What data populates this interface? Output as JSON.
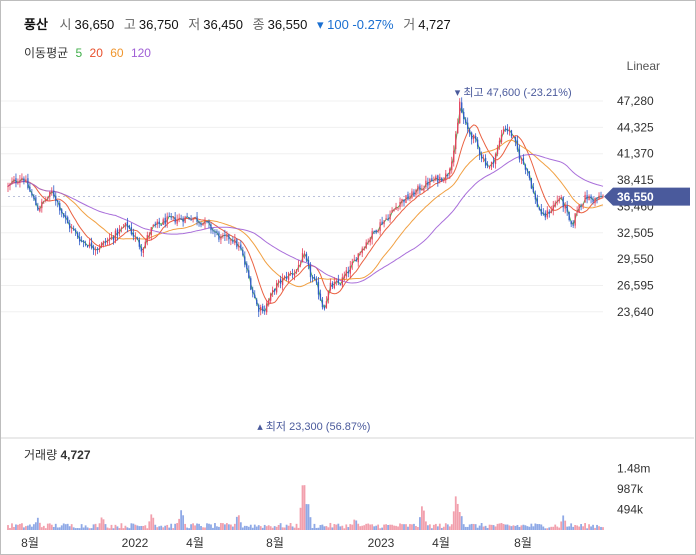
{
  "header": {
    "name": "풍산",
    "open_label": "시",
    "open": "36,650",
    "high_label": "고",
    "high": "36,750",
    "low_label": "저",
    "low": "36,450",
    "close_label": "종",
    "close": "36,550",
    "change": "▾ 100 -0.27%",
    "volume_label": "거",
    "volume": "4,727"
  },
  "moving_average": {
    "label": "이동평균",
    "periods": [
      {
        "text": "5",
        "color": "#3fae49"
      },
      {
        "text": "20",
        "color": "#e8502d"
      },
      {
        "text": "60",
        "color": "#f0962e"
      },
      {
        "text": "120",
        "color": "#a05fd6"
      }
    ]
  },
  "scale_label": "Linear",
  "volume_panel": {
    "title": "거래량",
    "value": "4,727"
  },
  "colors": {
    "up": "#e4405b",
    "down": "#2f5bc7",
    "current": "#4a5a9c",
    "ma60": "#f0962e",
    "ma120": "#a05fd6"
  },
  "chart_data": [
    {
      "type": "candlestick",
      "scale": "linear",
      "y_ticks": [
        "47,280",
        "44,325",
        "41,370",
        "38,415",
        "35,460",
        "32,505",
        "29,550",
        "26,595",
        "23,640"
      ],
      "x_ticks": [
        "8월",
        "2022",
        "4월",
        "8월",
        "2023",
        "4월",
        "8월"
      ],
      "ylim": [
        22200,
        49000
      ],
      "current_price": "36,550",
      "high_annotation": "최고 47,600 (-23.21%)",
      "low_annotation": "최저 23,300 (56.87%)",
      "anchors": [
        {
          "t": 0,
          "v": 37600
        },
        {
          "t": 5,
          "v": 38200
        },
        {
          "t": 15,
          "v": 38800
        },
        {
          "t": 30,
          "v": 35200
        },
        {
          "t": 45,
          "v": 37100
        },
        {
          "t": 60,
          "v": 33500
        },
        {
          "t": 75,
          "v": 31500
        },
        {
          "t": 90,
          "v": 30800
        },
        {
          "t": 105,
          "v": 32000
        },
        {
          "t": 120,
          "v": 33400
        },
        {
          "t": 135,
          "v": 30700
        },
        {
          "t": 145,
          "v": 33000
        },
        {
          "t": 160,
          "v": 33900
        },
        {
          "t": 175,
          "v": 34100
        },
        {
          "t": 185,
          "v": 34300
        },
        {
          "t": 200,
          "v": 33500
        },
        {
          "t": 215,
          "v": 31800
        },
        {
          "t": 225,
          "v": 32000
        },
        {
          "t": 235,
          "v": 30500
        },
        {
          "t": 245,
          "v": 26500
        },
        {
          "t": 252,
          "v": 24000
        },
        {
          "t": 260,
          "v": 24300
        },
        {
          "t": 270,
          "v": 26500
        },
        {
          "t": 282,
          "v": 27700
        },
        {
          "t": 290,
          "v": 28200
        },
        {
          "t": 298,
          "v": 30000
        },
        {
          "t": 305,
          "v": 27800
        },
        {
          "t": 312,
          "v": 26300
        },
        {
          "t": 318,
          "v": 24000
        },
        {
          "t": 325,
          "v": 26500
        },
        {
          "t": 335,
          "v": 26900
        },
        {
          "t": 345,
          "v": 28500
        },
        {
          "t": 355,
          "v": 30500
        },
        {
          "t": 365,
          "v": 32000
        },
        {
          "t": 375,
          "v": 33500
        },
        {
          "t": 385,
          "v": 34500
        },
        {
          "t": 395,
          "v": 36000
        },
        {
          "t": 405,
          "v": 36500
        },
        {
          "t": 415,
          "v": 37500
        },
        {
          "t": 425,
          "v": 38200
        },
        {
          "t": 435,
          "v": 38600
        },
        {
          "t": 443,
          "v": 39000
        },
        {
          "t": 450,
          "v": 42000
        },
        {
          "t": 456,
          "v": 46500
        },
        {
          "t": 462,
          "v": 44300
        },
        {
          "t": 470,
          "v": 43000
        },
        {
          "t": 478,
          "v": 41000
        },
        {
          "t": 486,
          "v": 39700
        },
        {
          "t": 494,
          "v": 42000
        },
        {
          "t": 500,
          "v": 44500
        },
        {
          "t": 508,
          "v": 43500
        },
        {
          "t": 516,
          "v": 41000
        },
        {
          "t": 524,
          "v": 39500
        },
        {
          "t": 532,
          "v": 36000
        },
        {
          "t": 540,
          "v": 34200
        },
        {
          "t": 548,
          "v": 35200
        },
        {
          "t": 556,
          "v": 36500
        },
        {
          "t": 562,
          "v": 35200
        },
        {
          "t": 568,
          "v": 33000
        },
        {
          "t": 575,
          "v": 35500
        },
        {
          "t": 583,
          "v": 36500
        },
        {
          "t": 591,
          "v": 36200
        },
        {
          "t": 600,
          "v": 36550
        }
      ],
      "high_point": {
        "t": 456,
        "v": 47600
      },
      "low_point": {
        "t": 258,
        "v": 23300
      }
    },
    {
      "type": "bar",
      "title": "거래량",
      "y_ticks": [
        "1.48m",
        "987k",
        "494k"
      ],
      "ylim": [
        0,
        1650000
      ],
      "spikes": [
        {
          "t": 30,
          "v": 300000
        },
        {
          "t": 95,
          "v": 350000
        },
        {
          "t": 145,
          "v": 420000
        },
        {
          "t": 175,
          "v": 520000
        },
        {
          "t": 232,
          "v": 420000
        },
        {
          "t": 298,
          "v": 1350000
        },
        {
          "t": 302,
          "v": 780000
        },
        {
          "t": 350,
          "v": 300000
        },
        {
          "t": 418,
          "v": 650000
        },
        {
          "t": 452,
          "v": 900000
        },
        {
          "t": 456,
          "v": 480000
        },
        {
          "t": 560,
          "v": 360000
        }
      ]
    }
  ]
}
